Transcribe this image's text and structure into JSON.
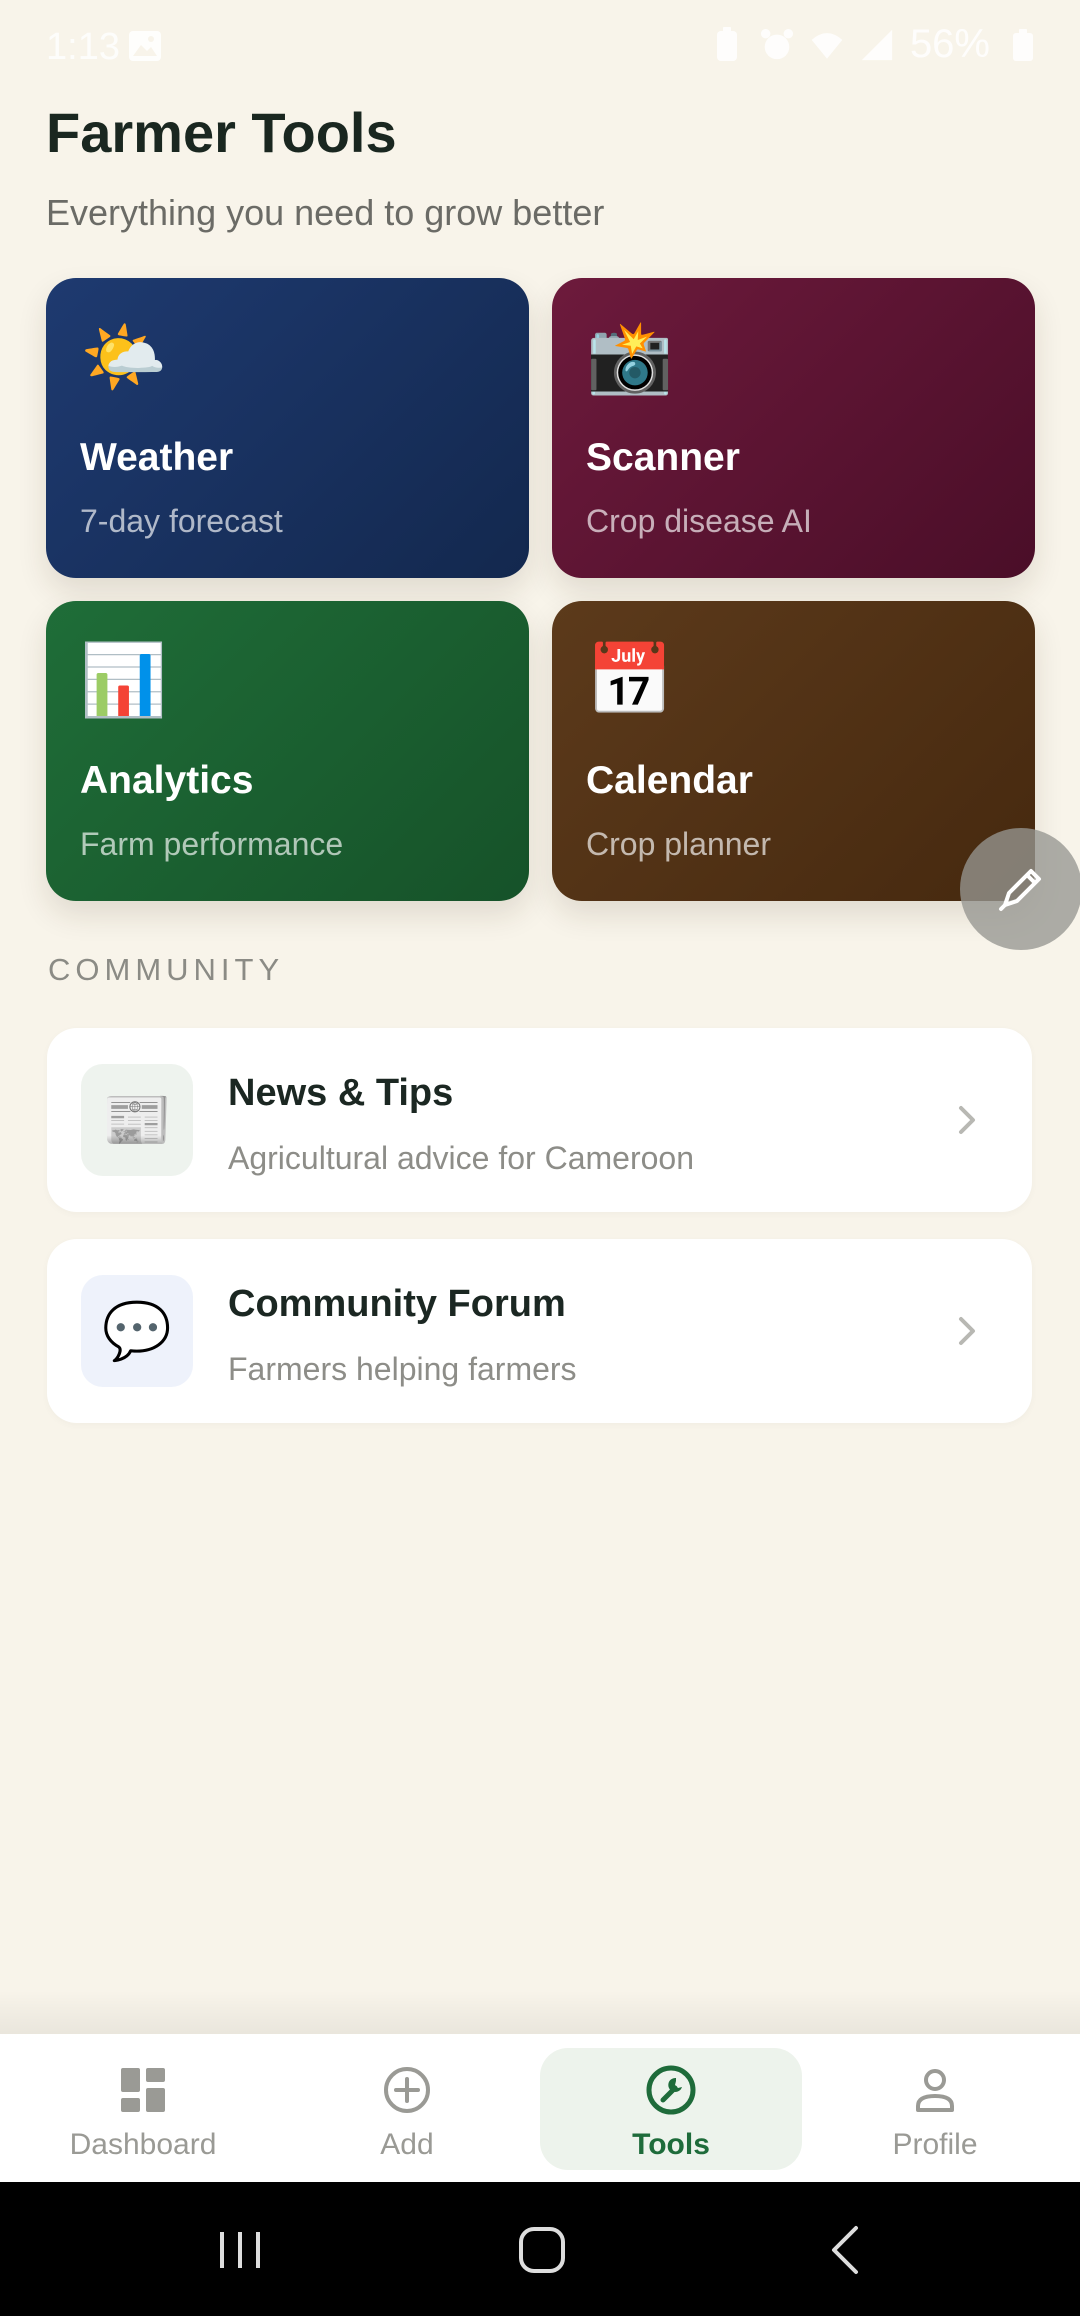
{
  "status_bar": {
    "time": "1:13",
    "battery": "56%",
    "icons": [
      "image-icon",
      "battery-saver-icon",
      "alarm-icon",
      "wifi-icon",
      "signal-icon",
      "battery-icon"
    ]
  },
  "header": {
    "title": "Farmer Tools",
    "subtitle": "Everything you need to grow better"
  },
  "tools": [
    {
      "id": "weather",
      "emoji": "🌤️",
      "icon": "sun-cloud-icon",
      "title": "Weather",
      "subtitle": "7-day forecast",
      "color": "#1E3A70"
    },
    {
      "id": "scanner",
      "emoji": "📸",
      "icon": "camera-flash-icon",
      "title": "Scanner",
      "subtitle": "Crop disease AI",
      "color": "#6D1A3C"
    },
    {
      "id": "analytics",
      "emoji": "📊",
      "icon": "bar-chart-icon",
      "title": "Analytics",
      "subtitle": "Farm performance",
      "color": "#1F6D38"
    },
    {
      "id": "calendar",
      "emoji": "📅",
      "icon": "calendar-icon",
      "title": "Calendar",
      "subtitle": "Crop planner",
      "color": "#5C3A1B"
    }
  ],
  "community": {
    "section_label": "COMMUNITY",
    "items": [
      {
        "emoji": "📰",
        "icon": "newspaper-icon",
        "title": "News & Tips",
        "subtitle": "Agricultural advice for Cameroon",
        "icon_bg": "#EEF3EE"
      },
      {
        "emoji": "💬",
        "icon": "speech-bubble-icon",
        "title": "Community Forum",
        "subtitle": "Farmers helping farmers",
        "icon_bg": "#EEF2FB"
      }
    ]
  },
  "bottom_nav": {
    "active": "Tools",
    "items": [
      {
        "label": "Dashboard",
        "icon": "dashboard-icon"
      },
      {
        "label": "Add",
        "icon": "add-circle-icon"
      },
      {
        "label": "Tools",
        "icon": "wrench-icon"
      },
      {
        "label": "Profile",
        "icon": "person-icon"
      }
    ]
  },
  "colors": {
    "background": "#F8F4EA",
    "accent": "#1E6B3A",
    "nav_active_bg": "#EDF3EC"
  }
}
